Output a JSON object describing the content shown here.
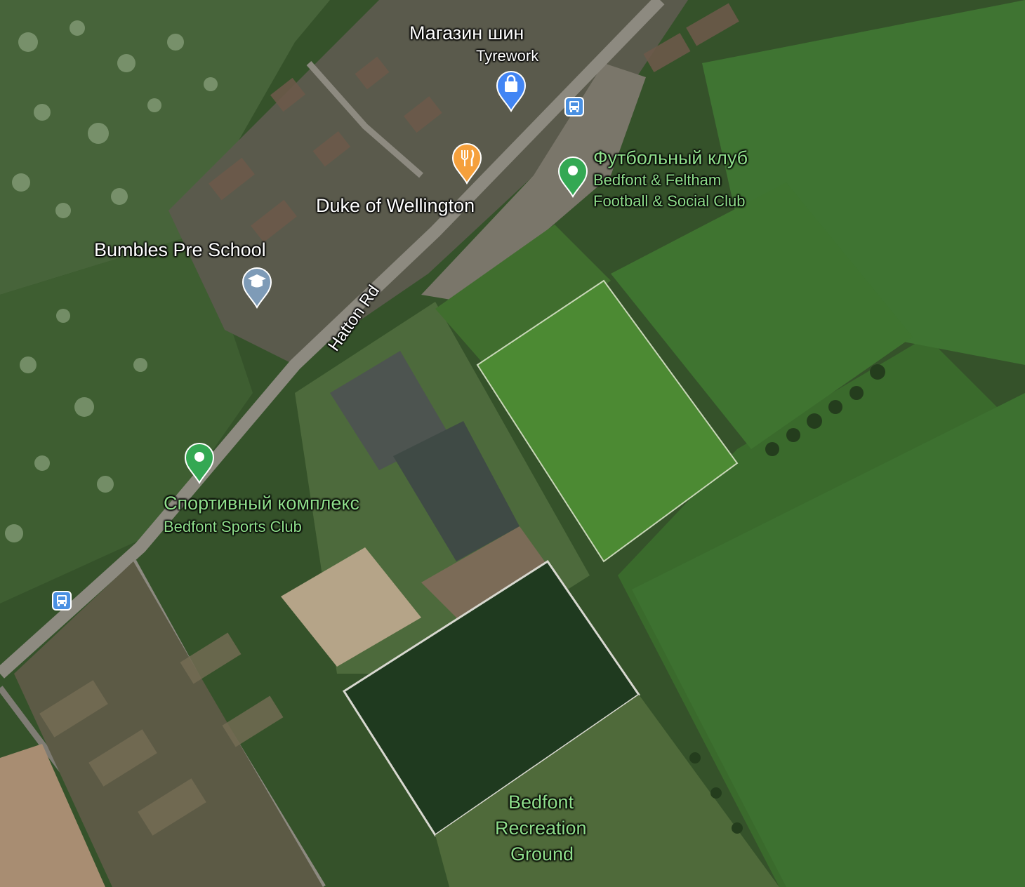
{
  "colors": {
    "poi_green": "#34a853",
    "poi_blue": "#4285f4",
    "poi_orange": "#f5a03c",
    "poi_school": "#7e9bb7",
    "transit_blue": "#4a90e2",
    "park_label": "#8fdf8b"
  },
  "places": {
    "tyre_shop": {
      "category": "Магазин шин",
      "name": "Tyrework",
      "icon": "shopping-bag-icon"
    },
    "pub": {
      "name": "Duke of Wellington",
      "icon": "restaurant-icon"
    },
    "football_club": {
      "category": "Футбольный клуб",
      "name_line1": "Bedfont & Feltham",
      "name_line2": "Football & Social Club",
      "icon": "place-pin-icon"
    },
    "school": {
      "name": "Bumbles Pre School",
      "icon": "graduation-cap-icon"
    },
    "sports_complex": {
      "category": "Спортивный комплекс",
      "name": "Bedfont Sports Club",
      "icon": "place-pin-icon"
    },
    "recreation": {
      "line1": "Bedfont",
      "line2": "Recreation",
      "line3": "Ground"
    }
  },
  "roads": {
    "main": "Hatton Rd"
  },
  "transit": {
    "stops": [
      "bus-stop-icon",
      "bus-stop-icon"
    ]
  }
}
